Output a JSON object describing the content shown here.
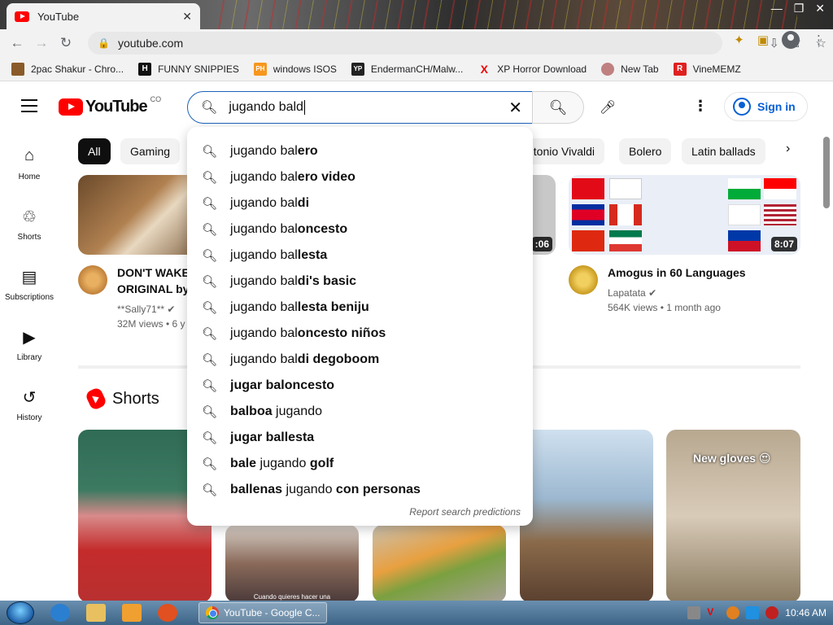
{
  "browser": {
    "tab_title": "YouTube",
    "url": "youtube.com",
    "bookmarks": [
      {
        "label": "2pac Shakur - Chro...",
        "icon": "tupac-icon",
        "color": "#8a5a2a",
        "glyph": ""
      },
      {
        "label": "FUNNY SNIPPIES",
        "icon": "h-icon",
        "color": "#111111",
        "glyph": "H"
      },
      {
        "label": "windows ISOS",
        "icon": "ph-icon",
        "color": "#f7971d",
        "glyph": "PH"
      },
      {
        "label": "EndermanCH/Malw...",
        "icon": "yp-icon",
        "color": "#222222",
        "glyph": "YP"
      },
      {
        "label": "XP Horror Download",
        "icon": "x-icon",
        "color": "#ffffff",
        "glyph": "X"
      },
      {
        "label": "New Tab",
        "icon": "globe-icon",
        "color": "#c08080",
        "glyph": ""
      },
      {
        "label": "VineMEMZ",
        "icon": "r-icon",
        "color": "#e02020",
        "glyph": "R"
      }
    ]
  },
  "header": {
    "logo_text": "YouTube",
    "country_code": "CO",
    "search_value": "jugando bald",
    "signin_label": "Sign in"
  },
  "sidebar": [
    {
      "label": "Home",
      "icon": "home-icon",
      "glyph": "⌂"
    },
    {
      "label": "Shorts",
      "icon": "shorts-icon",
      "glyph": "♲"
    },
    {
      "label": "Subscriptions",
      "icon": "subscriptions-icon",
      "glyph": "▤"
    },
    {
      "label": "Library",
      "icon": "library-icon",
      "glyph": "▶"
    },
    {
      "label": "History",
      "icon": "history-icon",
      "glyph": "↺"
    }
  ],
  "chips": [
    "All",
    "Gaming",
    "ntonio Vivaldi",
    "Bolero",
    "Latin ballads"
  ],
  "suggestions": [
    {
      "plain": "jugando bal",
      "bold": "ero",
      "after": "",
      "tail": ""
    },
    {
      "plain": "jugando bal",
      "bold": "ero video",
      "after": "",
      "tail": ""
    },
    {
      "plain": "jugando bal",
      "bold": "di",
      "after": "",
      "tail": ""
    },
    {
      "plain": "jugando bal",
      "bold": "oncesto",
      "after": "",
      "tail": ""
    },
    {
      "plain": "jugando bal",
      "bold": "lesta",
      "after": "",
      "tail": ""
    },
    {
      "plain": "jugando bal",
      "bold": "di's basic",
      "after": "",
      "tail": ""
    },
    {
      "plain": "jugando bal",
      "bold": "lesta beniju",
      "after": "",
      "tail": ""
    },
    {
      "plain": "jugando bal",
      "bold": "oncesto niños",
      "after": "",
      "tail": ""
    },
    {
      "plain": "jugando bal",
      "bold": "di degoboom",
      "after": "",
      "tail": ""
    },
    {
      "plain": "",
      "bold": "jugar baloncesto",
      "after": "",
      "tail": ""
    },
    {
      "plain": "",
      "bold": "balboa",
      "after": " jugando",
      "tail": ""
    },
    {
      "plain": "",
      "bold": "jugar ballesta",
      "after": "",
      "tail": ""
    },
    {
      "plain": "",
      "bold": "bale",
      "after": " jugando ",
      "tail": "golf"
    },
    {
      "plain": "",
      "bold": "ballenas",
      "after": " jugando ",
      "tail": "con personas"
    }
  ],
  "report_label": "Report search predictions",
  "videos": [
    {
      "title_1": "DON'T WAKE",
      "title_2": "ORIGINAL by",
      "channel": "**Sally71**",
      "meta": "32M views • 6 y"
    },
    {
      "title_1": "Amogus in 60 Languages",
      "title_2": "",
      "channel": "Lapatata",
      "meta": "564K views • 1 month ago",
      "duration": "8:07"
    }
  ],
  "partial_duration": ":06",
  "shorts": {
    "title": "Shorts",
    "short_caption": "Cuando quieres hacer una",
    "overlay_text": "New gloves 😍"
  },
  "taskbar": {
    "task_label": "YouTube - Google C...",
    "clock": "10:46 AM"
  }
}
